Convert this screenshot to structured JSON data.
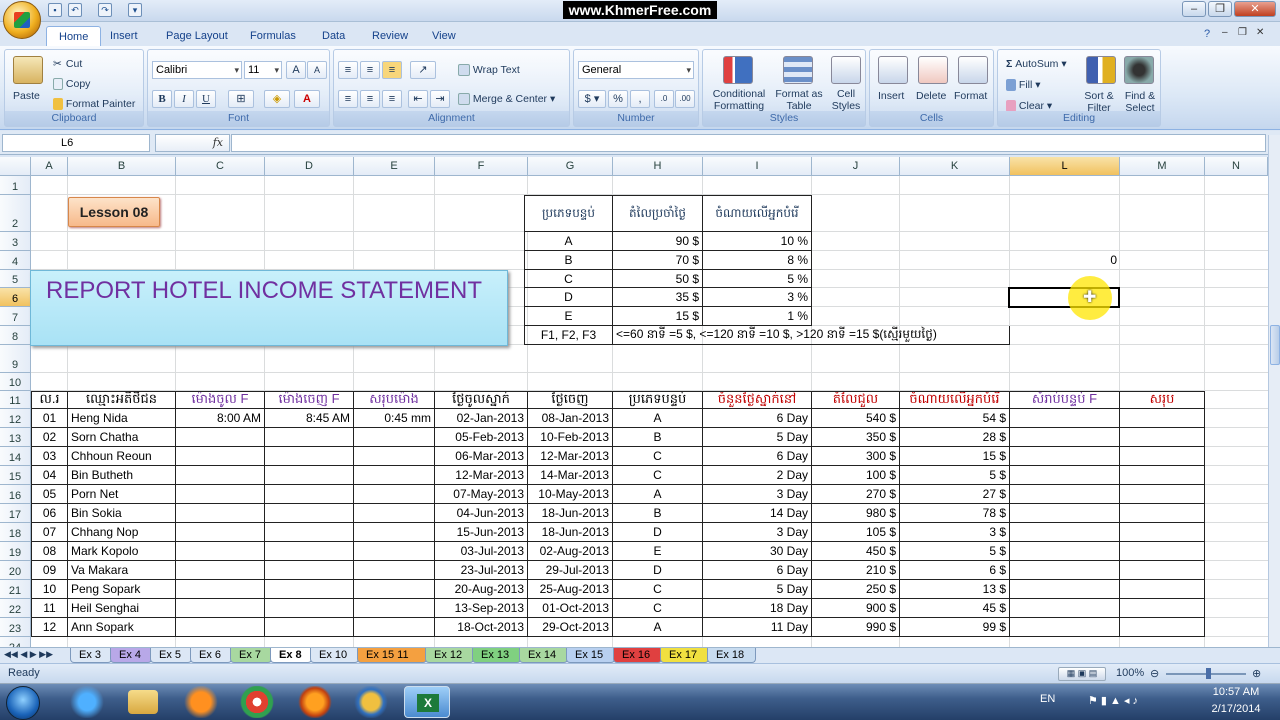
{
  "watermark": "www.KhmerFree.com",
  "ribbon": {
    "tabs": [
      "Home",
      "Insert",
      "Page Layout",
      "Formulas",
      "Data",
      "Review",
      "View"
    ],
    "clipboard": {
      "paste": "Paste",
      "cut": "Cut",
      "copy": "Copy",
      "format_painter": "Format Painter",
      "label": "Clipboard"
    },
    "font": {
      "name": "Calibri",
      "size": "11",
      "label": "Font"
    },
    "alignment": {
      "wrap": "Wrap Text",
      "merge": "Merge & Center",
      "label": "Alignment"
    },
    "number": {
      "format": "General",
      "label": "Number"
    },
    "styles": {
      "conditional": "Conditional Formatting",
      "format_table": "Format as Table",
      "cell_styles": "Cell Styles",
      "label": "Styles"
    },
    "cells": {
      "insert": "Insert",
      "delete": "Delete",
      "format": "Format",
      "label": "Cells"
    },
    "editing": {
      "autosum": "AutoSum",
      "fill": "Fill",
      "clear": "Clear",
      "sort": "Sort & Filter",
      "find": "Find & Select",
      "label": "Editing"
    }
  },
  "formula_bar": {
    "name_box": "L6",
    "fx": "fx",
    "value": ""
  },
  "columns": [
    "A",
    "B",
    "C",
    "D",
    "E",
    "F",
    "G",
    "H",
    "I",
    "J",
    "K",
    "L",
    "M",
    "N"
  ],
  "selected_column": "L",
  "selected_row": "6",
  "lesson_label": "Lesson 08",
  "report_title": "REPORT HOTEL INCOME STATEMENT",
  "rate_table": {
    "headers": [
      "ប្រភេទបន្ទប់",
      "តំលៃប្រចាំថ្ងៃ",
      "ចំណាយលើអ្នកបំរើ"
    ],
    "rows": [
      [
        "A",
        "90 $",
        "10 %"
      ],
      [
        "B",
        "70 $",
        "8 %"
      ],
      [
        "C",
        "50 $",
        "5 %"
      ],
      [
        "D",
        "35 $",
        "3 %"
      ],
      [
        "E",
        "15 $",
        "1 %"
      ]
    ],
    "f_label": "F1, F2, F3",
    "f_rule": "<=60 នាទី =5 $, <=120 នាទី =10 $, >120 នាទី =15 $(ស្មើរមួយថ្ងៃ)"
  },
  "l4_value": "0",
  "main_table": {
    "headers": [
      "ល.រ",
      "ឈ្មោះអតិថិជន",
      "ម៉ោងចូល F",
      "ម៉ោងចេញ F",
      "សរុបម៉ោង",
      "ថ្ងៃចូលស្នាក់",
      "ថ្ងៃចេញ",
      "ប្រភេទបន្ទប់",
      "ចំនួនថ្ងៃស្នាក់នៅ",
      "តំលៃជួល",
      "ចំណាយលើអ្នកបំរើ",
      "សំរាប់បន្ទប់ F",
      "សរុប"
    ],
    "rows": [
      [
        "01",
        "Heng Nida",
        "8:00 AM",
        "8:45 AM",
        "0:45 mm",
        "02-Jan-2013",
        "08-Jan-2013",
        "A",
        "6 Day",
        "540 $",
        "54 $"
      ],
      [
        "02",
        "Sorn Chatha",
        "",
        "",
        "",
        "05-Feb-2013",
        "10-Feb-2013",
        "B",
        "5 Day",
        "350 $",
        "28 $"
      ],
      [
        "03",
        "Chhoun Reoun",
        "",
        "",
        "",
        "06-Mar-2013",
        "12-Mar-2013",
        "C",
        "6 Day",
        "300 $",
        "15 $"
      ],
      [
        "04",
        "Bin Butheth",
        "",
        "",
        "",
        "12-Mar-2013",
        "14-Mar-2013",
        "C",
        "2 Day",
        "100 $",
        "5 $"
      ],
      [
        "05",
        "Porn Net",
        "",
        "",
        "",
        "07-May-2013",
        "10-May-2013",
        "A",
        "3 Day",
        "270 $",
        "27 $"
      ],
      [
        "06",
        "Bin Sokia",
        "",
        "",
        "",
        "04-Jun-2013",
        "18-Jun-2013",
        "B",
        "14 Day",
        "980 $",
        "78 $"
      ],
      [
        "07",
        "Chhang Nop",
        "",
        "",
        "",
        "15-Jun-2013",
        "18-Jun-2013",
        "D",
        "3 Day",
        "105 $",
        "3 $"
      ],
      [
        "08",
        "Mark Kopolo",
        "",
        "",
        "",
        "03-Jul-2013",
        "02-Aug-2013",
        "E",
        "30 Day",
        "450 $",
        "5 $"
      ],
      [
        "09",
        "Va Makara",
        "",
        "",
        "",
        "23-Jul-2013",
        "29-Jul-2013",
        "D",
        "6 Day",
        "210 $",
        "6 $"
      ],
      [
        "10",
        "Peng Sopark",
        "",
        "",
        "",
        "20-Aug-2013",
        "25-Aug-2013",
        "C",
        "5 Day",
        "250 $",
        "13 $"
      ],
      [
        "11",
        "Heil Senghai",
        "",
        "",
        "",
        "13-Sep-2013",
        "01-Oct-2013",
        "C",
        "18 Day",
        "900 $",
        "45 $"
      ],
      [
        "12",
        "Ann Sopark",
        "",
        "",
        "",
        "18-Oct-2013",
        "29-Oct-2013",
        "A",
        "11 Day",
        "990 $",
        "99 $"
      ]
    ]
  },
  "sheet_tabs": [
    "Ex 3",
    "Ex 4",
    "Ex 5",
    "Ex 6",
    "Ex 7",
    "Ex 8",
    "Ex 10",
    "Ex 15 11",
    "Ex 12",
    "Ex 13",
    "Ex 14",
    "Ex 15",
    "Ex 16",
    "Ex 17",
    "Ex 18"
  ],
  "active_sheet": "Ex 8",
  "status": {
    "ready": "Ready",
    "zoom": "100%"
  },
  "taskbar": {
    "lang": "EN",
    "time": "10:57 AM",
    "date": "2/17/2014"
  }
}
